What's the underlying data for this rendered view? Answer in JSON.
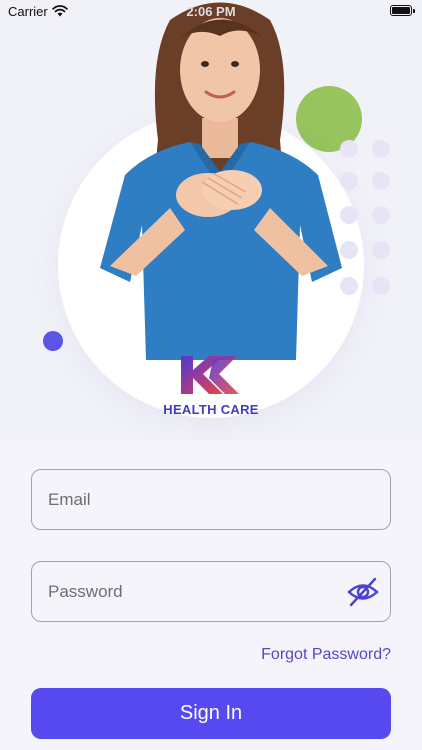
{
  "status_bar": {
    "carrier": "Carrier",
    "time": "2:06 PM"
  },
  "hero": {
    "logo_alt": "KK logo",
    "brand_name": "HEALTH CARE",
    "image_description": "nurse-photo"
  },
  "form": {
    "email_placeholder": "Email",
    "password_placeholder": "Password",
    "password_toggle_icon": "eye-slash-icon",
    "forgot_label": "Forgot Password?",
    "signin_label": "Sign In"
  },
  "colors": {
    "accent": "#5649f0",
    "link": "#5048c9",
    "brand_text": "#3f3ec4",
    "green_circle": "#97c45d",
    "background": "#f4f4fa"
  }
}
